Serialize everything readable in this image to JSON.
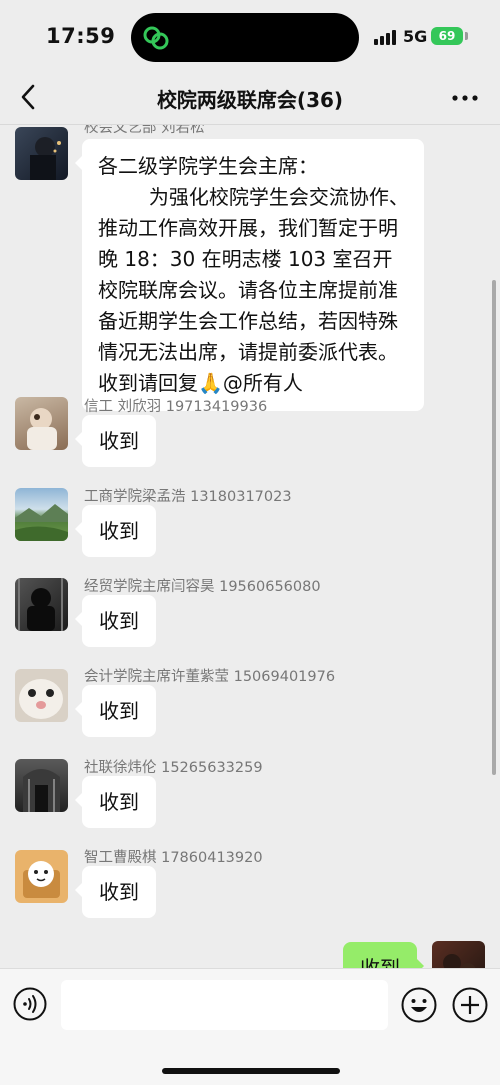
{
  "status_bar": {
    "time": "17:59",
    "network": "5G",
    "battery": "69"
  },
  "nav": {
    "title": "校院两级联席会(36)"
  },
  "messages": [
    {
      "sender": "校会文艺部 刘若松",
      "text": "各二级学院学生会主席：\n        为强化校院学生会交流协作、推动工作高效开展，我们暂定于明晚 18：30 在明志楼 103 室召开校院联席会议。请各位主席提前准备近期学生会工作总结，若因特殊情况无法出席，请提前委派代表。收到请回复🙏@所有人"
    },
    {
      "sender": "信工 刘欣羽 19713419936",
      "text": "收到"
    },
    {
      "sender": "工商学院梁孟浩 13180317023",
      "text": "收到"
    },
    {
      "sender": "经贸学院主席闫容昊 19560656080",
      "text": "收到"
    },
    {
      "sender": "会计学院主席许董紫莹 15069401976",
      "text": "收到"
    },
    {
      "sender": "社联徐炜伦 15265633259",
      "text": "收到"
    },
    {
      "sender": "智工曹殿棋 17860413920",
      "text": "收到"
    }
  ],
  "my_message": {
    "text": "收到"
  },
  "input": {
    "placeholder": ""
  },
  "icons": {
    "status": "wechat-link-icon",
    "back": "chevron-left-icon",
    "more": "more-dots-icon",
    "voice": "voice-icon",
    "emoji": "emoji-icon",
    "plus": "plus-circle-icon"
  },
  "colors": {
    "my_bubble": "#95ec69",
    "battery": "#34c759",
    "background": "#ededed"
  }
}
